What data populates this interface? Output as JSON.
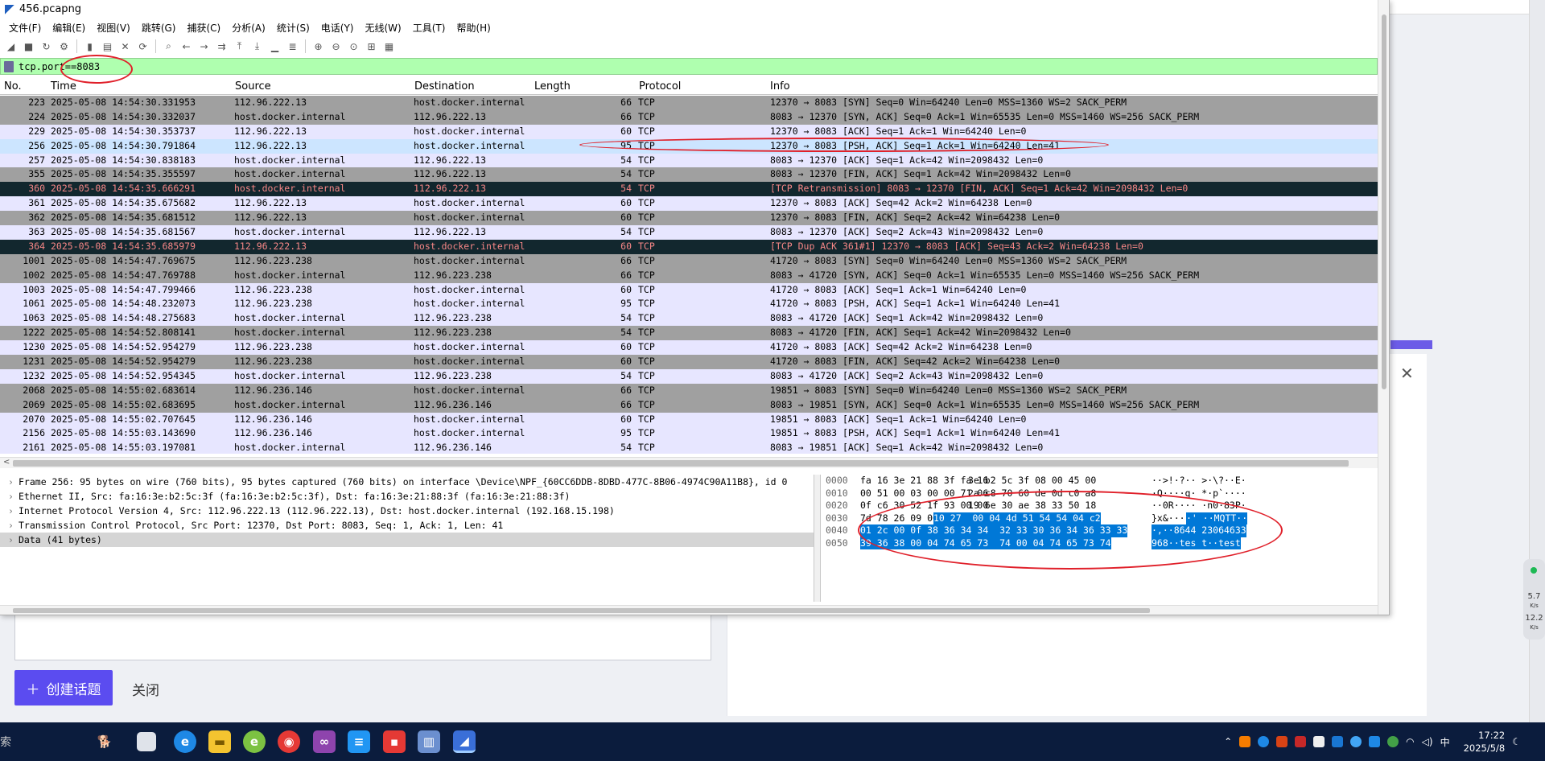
{
  "window": {
    "title": "456.pcapng",
    "menu": [
      "文件(F)",
      "编辑(E)",
      "视图(V)",
      "跳转(G)",
      "捕获(C)",
      "分析(A)",
      "统计(S)",
      "电话(Y)",
      "无线(W)",
      "工具(T)",
      "帮助(H)"
    ],
    "filter_value": "tcp.port==8083"
  },
  "toolbar_icons": [
    "shark-fin-start-icon",
    "stop-icon",
    "restart-icon",
    "options-icon",
    "open-file-icon",
    "save-icon",
    "close-file-icon",
    "reload-icon",
    "find-icon",
    "back-icon",
    "forward-icon",
    "goto-icon",
    "first-icon",
    "last-icon",
    "autoscroll-icon",
    "colorize-icon",
    "zoom-in-icon",
    "zoom-out-icon",
    "zoom-reset-icon",
    "resize-columns-icon",
    "layout-icon"
  ],
  "packet_list": {
    "columns": [
      "No.",
      "Time",
      "Source",
      "Destination",
      "Length",
      "Protocol",
      "Info"
    ],
    "rows": [
      {
        "no": "223",
        "time": "2025-05-08 14:54:30.331953",
        "src": "112.96.222.13",
        "dst": "host.docker.internal",
        "len": "66",
        "proto": "TCP",
        "info": "12370 → 8083 [SYN] Seq=0 Win=64240 Len=0 MSS=1360 WS=2 SACK_PERM",
        "style": "gray"
      },
      {
        "no": "224",
        "time": "2025-05-08 14:54:30.332037",
        "src": "host.docker.internal",
        "dst": "112.96.222.13",
        "len": "66",
        "proto": "TCP",
        "info": "8083 → 12370 [SYN, ACK] Seq=0 Ack=1 Win=65535 Len=0 MSS=1460 WS=256 SACK_PERM",
        "style": "gray"
      },
      {
        "no": "229",
        "time": "2025-05-08 14:54:30.353737",
        "src": "112.96.222.13",
        "dst": "host.docker.internal",
        "len": "60",
        "proto": "TCP",
        "info": "12370 → 8083 [ACK] Seq=1 Ack=1 Win=64240 Len=0",
        "style": "lav"
      },
      {
        "no": "256",
        "time": "2025-05-08 14:54:30.791864",
        "src": "112.96.222.13",
        "dst": "host.docker.internal",
        "len": "95",
        "proto": "TCP",
        "info": "12370 → 8083 [PSH, ACK] Seq=1 Ack=1 Win=64240 Len=41",
        "style": "sel"
      },
      {
        "no": "257",
        "time": "2025-05-08 14:54:30.838183",
        "src": "host.docker.internal",
        "dst": "112.96.222.13",
        "len": "54",
        "proto": "TCP",
        "info": "8083 → 12370 [ACK] Seq=1 Ack=42 Win=2098432 Len=0",
        "style": "lav"
      },
      {
        "no": "355",
        "time": "2025-05-08 14:54:35.355597",
        "src": "host.docker.internal",
        "dst": "112.96.222.13",
        "len": "54",
        "proto": "TCP",
        "info": "8083 → 12370 [FIN, ACK] Seq=1 Ack=42 Win=2098432 Len=0",
        "style": "gray"
      },
      {
        "no": "360",
        "time": "2025-05-08 14:54:35.666291",
        "src": "host.docker.internal",
        "dst": "112.96.222.13",
        "len": "54",
        "proto": "TCP",
        "info": "[TCP Retransmission] 8083 → 12370 [FIN, ACK] Seq=1 Ack=42 Win=2098432 Len=0",
        "style": "dark"
      },
      {
        "no": "361",
        "time": "2025-05-08 14:54:35.675682",
        "src": "112.96.222.13",
        "dst": "host.docker.internal",
        "len": "60",
        "proto": "TCP",
        "info": "12370 → 8083 [ACK] Seq=42 Ack=2 Win=64238 Len=0",
        "style": "lav"
      },
      {
        "no": "362",
        "time": "2025-05-08 14:54:35.681512",
        "src": "112.96.222.13",
        "dst": "host.docker.internal",
        "len": "60",
        "proto": "TCP",
        "info": "12370 → 8083 [FIN, ACK] Seq=2 Ack=42 Win=64238 Len=0",
        "style": "gray"
      },
      {
        "no": "363",
        "time": "2025-05-08 14:54:35.681567",
        "src": "host.docker.internal",
        "dst": "112.96.222.13",
        "len": "54",
        "proto": "TCP",
        "info": "8083 → 12370 [ACK] Seq=2 Ack=43 Win=2098432 Len=0",
        "style": "lav"
      },
      {
        "no": "364",
        "time": "2025-05-08 14:54:35.685979",
        "src": "112.96.222.13",
        "dst": "host.docker.internal",
        "len": "60",
        "proto": "TCP",
        "info": "[TCP Dup ACK 361#1] 12370 → 8083 [ACK] Seq=43 Ack=2 Win=64238 Len=0",
        "style": "dark"
      },
      {
        "no": "1001",
        "time": "2025-05-08 14:54:47.769675",
        "src": "112.96.223.238",
        "dst": "host.docker.internal",
        "len": "66",
        "proto": "TCP",
        "info": "41720 → 8083 [SYN] Seq=0 Win=64240 Len=0 MSS=1360 WS=2 SACK_PERM",
        "style": "gray"
      },
      {
        "no": "1002",
        "time": "2025-05-08 14:54:47.769788",
        "src": "host.docker.internal",
        "dst": "112.96.223.238",
        "len": "66",
        "proto": "TCP",
        "info": "8083 → 41720 [SYN, ACK] Seq=0 Ack=1 Win=65535 Len=0 MSS=1460 WS=256 SACK_PERM",
        "style": "gray"
      },
      {
        "no": "1003",
        "time": "2025-05-08 14:54:47.799466",
        "src": "112.96.223.238",
        "dst": "host.docker.internal",
        "len": "60",
        "proto": "TCP",
        "info": "41720 → 8083 [ACK] Seq=1 Ack=1 Win=64240 Len=0",
        "style": "lav"
      },
      {
        "no": "1061",
        "time": "2025-05-08 14:54:48.232073",
        "src": "112.96.223.238",
        "dst": "host.docker.internal",
        "len": "95",
        "proto": "TCP",
        "info": "41720 → 8083 [PSH, ACK] Seq=1 Ack=1 Win=64240 Len=41",
        "style": "lav"
      },
      {
        "no": "1063",
        "time": "2025-05-08 14:54:48.275683",
        "src": "host.docker.internal",
        "dst": "112.96.223.238",
        "len": "54",
        "proto": "TCP",
        "info": "8083 → 41720 [ACK] Seq=1 Ack=42 Win=2098432 Len=0",
        "style": "lav"
      },
      {
        "no": "1222",
        "time": "2025-05-08 14:54:52.808141",
        "src": "host.docker.internal",
        "dst": "112.96.223.238",
        "len": "54",
        "proto": "TCP",
        "info": "8083 → 41720 [FIN, ACK] Seq=1 Ack=42 Win=2098432 Len=0",
        "style": "gray"
      },
      {
        "no": "1230",
        "time": "2025-05-08 14:54:52.954279",
        "src": "112.96.223.238",
        "dst": "host.docker.internal",
        "len": "60",
        "proto": "TCP",
        "info": "41720 → 8083 [ACK] Seq=42 Ack=2 Win=64238 Len=0",
        "style": "lav"
      },
      {
        "no": "1231",
        "time": "2025-05-08 14:54:52.954279",
        "src": "112.96.223.238",
        "dst": "host.docker.internal",
        "len": "60",
        "proto": "TCP",
        "info": "41720 → 8083 [FIN, ACK] Seq=42 Ack=2 Win=64238 Len=0",
        "style": "gray"
      },
      {
        "no": "1232",
        "time": "2025-05-08 14:54:52.954345",
        "src": "host.docker.internal",
        "dst": "112.96.223.238",
        "len": "54",
        "proto": "TCP",
        "info": "8083 → 41720 [ACK] Seq=2 Ack=43 Win=2098432 Len=0",
        "style": "lav"
      },
      {
        "no": "2068",
        "time": "2025-05-08 14:55:02.683614",
        "src": "112.96.236.146",
        "dst": "host.docker.internal",
        "len": "66",
        "proto": "TCP",
        "info": "19851 → 8083 [SYN] Seq=0 Win=64240 Len=0 MSS=1360 WS=2 SACK_PERM",
        "style": "gray"
      },
      {
        "no": "2069",
        "time": "2025-05-08 14:55:02.683695",
        "src": "host.docker.internal",
        "dst": "112.96.236.146",
        "len": "66",
        "proto": "TCP",
        "info": "8083 → 19851 [SYN, ACK] Seq=0 Ack=1 Win=65535 Len=0 MSS=1460 WS=256 SACK_PERM",
        "style": "gray"
      },
      {
        "no": "2070",
        "time": "2025-05-08 14:55:02.707645",
        "src": "112.96.236.146",
        "dst": "host.docker.internal",
        "len": "60",
        "proto": "TCP",
        "info": "19851 → 8083 [ACK] Seq=1 Ack=1 Win=64240 Len=0",
        "style": "lav"
      },
      {
        "no": "2156",
        "time": "2025-05-08 14:55:03.143690",
        "src": "112.96.236.146",
        "dst": "host.docker.internal",
        "len": "95",
        "proto": "TCP",
        "info": "19851 → 8083 [PSH, ACK] Seq=1 Ack=1 Win=64240 Len=41",
        "style": "lav"
      },
      {
        "no": "2161",
        "time": "2025-05-08 14:55:03.197081",
        "src": "host.docker.internal",
        "dst": "112.96.236.146",
        "len": "54",
        "proto": "TCP",
        "info": "8083 → 19851 [ACK] Seq=1 Ack=42 Win=2098432 Len=0",
        "style": "lav"
      }
    ]
  },
  "details": [
    {
      "text": "Frame 256: 95 bytes on wire (760 bits), 95 bytes captured (760 bits) on interface \\Device\\NPF_{60CC6DDB-8DBD-477C-8B06-4974C90A11B8}, id 0",
      "selected": false
    },
    {
      "text": "Ethernet II, Src: fa:16:3e:b2:5c:3f (fa:16:3e:b2:5c:3f), Dst: fa:16:3e:21:88:3f (fa:16:3e:21:88:3f)",
      "selected": false
    },
    {
      "text": "Internet Protocol Version 4, Src: 112.96.222.13 (112.96.222.13), Dst: host.docker.internal (192.168.15.198)",
      "selected": false
    },
    {
      "text": "Transmission Control Protocol, Src Port: 12370, Dst Port: 8083, Seq: 1, Ack: 1, Len: 41",
      "selected": false
    },
    {
      "text": "Data (41 bytes)",
      "selected": true
    }
  ],
  "bytes": [
    {
      "off": "0000",
      "hex1": "fa 16 3e 21 88 3f fa 16",
      "hex2": "3e b2 5c 3f 08 00 45 00",
      "hex_hl": "",
      "asc": "··>!·?·· >·\\?··E·",
      "asc_hl": ""
    },
    {
      "off": "0010",
      "hex1": "00 51 00 03 00 00 71 06",
      "hex2": "2a c8 70 60 de 0d c0 a8",
      "hex_hl": "",
      "asc": "·Q····q· *·p`····",
      "asc_hl": ""
    },
    {
      "off": "0020",
      "hex1": "0f c6 30 52 1f 93 00 00",
      "hex2": "19 6e 30 ae 38 33 50 18",
      "hex_hl": "",
      "asc": "··0R···· ·n0·83P·",
      "asc_hl": ""
    },
    {
      "off": "0030",
      "hex1": "7d 78 26 09 00 00",
      "hex2": "",
      "hex_hl": "10 27  00 04 4d 51 54 54 04 c2",
      "asc": "}x&···",
      "asc_hl": "·' ··MQTT··"
    },
    {
      "off": "0040",
      "hex1": "",
      "hex2": "",
      "hex_hl": "01 2c 00 0f 38 36 34 34  32 33 30 36 34 36 33 33",
      "asc": "",
      "asc_hl": "·,··8644 23064633"
    },
    {
      "off": "0050",
      "hex1": "",
      "hex2": "",
      "hex_hl": "39 36 38 00 04 74 65 73  74 00 04 74 65 73 74",
      "asc": "",
      "asc_hl": "968··tes t··test"
    }
  ],
  "background_page": {
    "create_button": "创建话题",
    "close_button": "关闭",
    "speed_up": "5.7",
    "speed_down": "12.2",
    "speed_unit": "K/s"
  },
  "taskbar": {
    "search_fragment": "索",
    "time": "17:22",
    "date": "2025/5/8"
  },
  "colors": {
    "filter_ok": "#afffaf",
    "row_lavender": "#e7e6ff",
    "row_gray": "#a0a0a0",
    "row_dark": "#12272e",
    "row_dark_text": "#f78787",
    "selected_row": "#cce5ff",
    "bytes_highlight": "#0078d7",
    "annotation": "#e0202a",
    "accent": "#5b4cf0"
  }
}
